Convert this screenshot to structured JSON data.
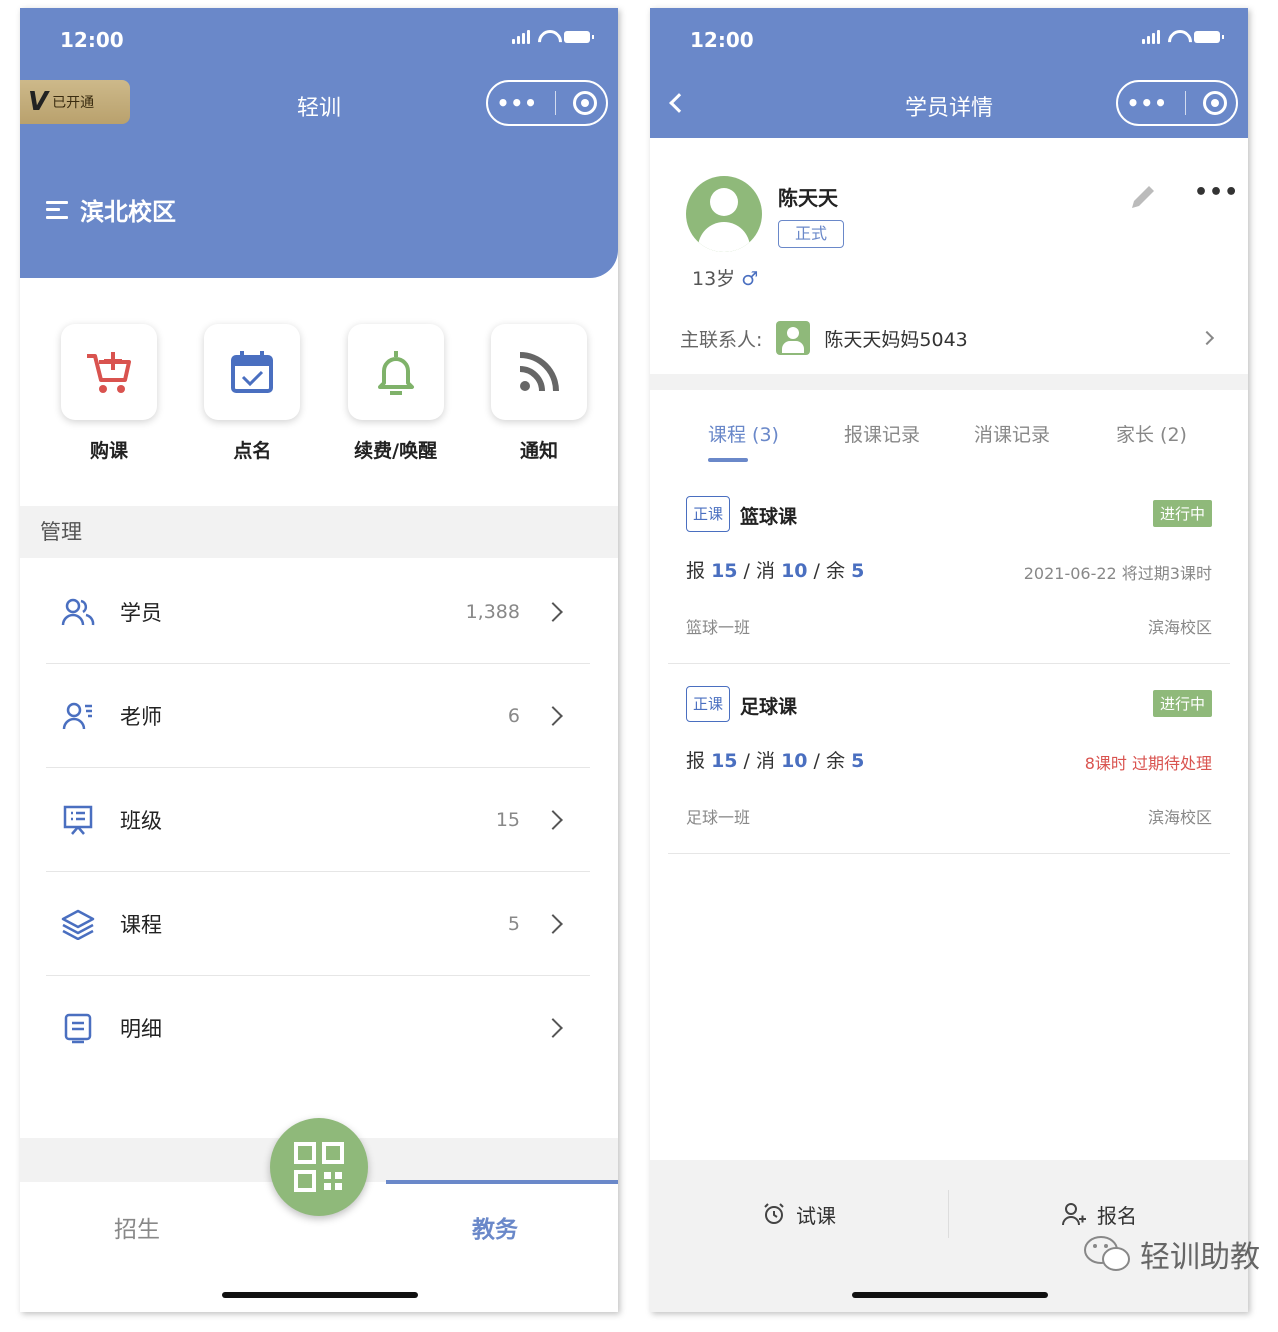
{
  "left_screen": {
    "status_time": "12:00",
    "vip_badge": {
      "mark": "V",
      "label": "已开通"
    },
    "title": "轻训",
    "campus": "滨北校区",
    "quick_actions": [
      {
        "label": "购课",
        "icon": "cart-icon",
        "color": "#d9534f"
      },
      {
        "label": "点名",
        "icon": "calendar-check-icon",
        "color": "#4a6fc0"
      },
      {
        "label": "续费/唤醒",
        "icon": "bell-icon",
        "color": "#7fb26a"
      },
      {
        "label": "通知",
        "icon": "rss-icon",
        "color": "#666666"
      }
    ],
    "manage_section_title": "管理",
    "manage_items": [
      {
        "label": "学员",
        "count": "1,388",
        "icon": "users-icon"
      },
      {
        "label": "老师",
        "count": "6",
        "icon": "teacher-icon"
      },
      {
        "label": "班级",
        "count": "15",
        "icon": "presentation-icon"
      },
      {
        "label": "课程",
        "count": "5",
        "icon": "layers-icon"
      },
      {
        "label": "明细",
        "count": "",
        "icon": "document-icon"
      }
    ],
    "tabbar": {
      "left": "招生",
      "right": "教务",
      "active": "教务"
    }
  },
  "right_screen": {
    "status_time": "12:00",
    "title": "学员详情",
    "student": {
      "name": "陈天天",
      "type": "正式",
      "age": "13岁",
      "gender_symbol": "♂"
    },
    "contact": {
      "label": "主联系人:",
      "name": "陈天天妈妈5043"
    },
    "tabs": [
      "课程 (3)",
      "报课记录",
      "消课记录",
      "家长 (2)"
    ],
    "courses": [
      {
        "tag": "正课",
        "name": "篮球课",
        "status": "进行中",
        "enrolled": "15",
        "consumed": "10",
        "remaining": "5",
        "info": "2021-06-22 将过期3课时",
        "info_warn": false,
        "class": "篮球一班",
        "campus": "滨海校区"
      },
      {
        "tag": "正课",
        "name": "足球课",
        "status": "进行中",
        "enrolled": "15",
        "consumed": "10",
        "remaining": "5",
        "info": "8课时 过期待处理",
        "info_warn": true,
        "class": "足球一班",
        "campus": "滨海校区"
      }
    ],
    "stat_labels": {
      "enrolled": "报",
      "consumed": "消",
      "remaining": "余"
    },
    "bottom_buttons": {
      "trial": "试课",
      "enroll": "报名"
    }
  },
  "watermark": "轻训助教",
  "colors": {
    "primary": "#6a88c9",
    "accent_green": "#8fb97a",
    "warn_red": "#d9534f"
  }
}
